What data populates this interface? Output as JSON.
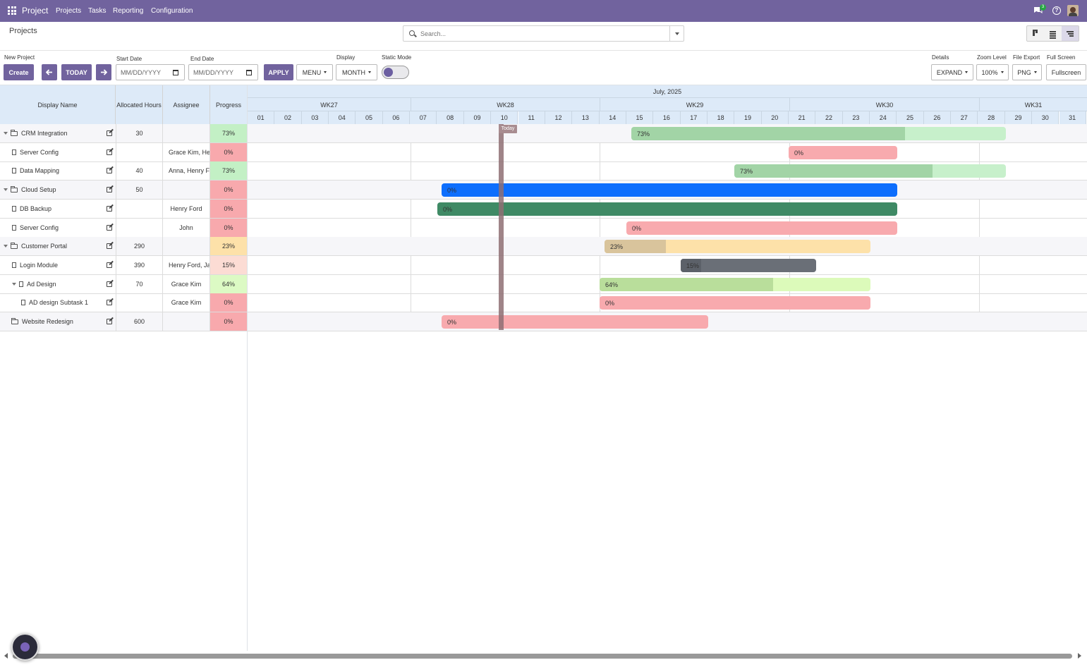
{
  "topbar": {
    "app": "Project",
    "menu": [
      "Projects",
      "Tasks",
      "Reporting",
      "Configuration"
    ],
    "badge": "3",
    "help": "?"
  },
  "control": {
    "breadcrumb": "Projects",
    "search_placeholder": "Search..."
  },
  "toolbar": {
    "new_project_label": "New Project",
    "create": "Create",
    "today": "TODAY",
    "start_date_label": "Start Date",
    "start_placeholder": "MM/DD/YYYY",
    "end_date_label": "End Date",
    "end_placeholder": "MM/DD/YYYY",
    "apply": "APPLY",
    "menu": "MENU",
    "display_label": "Display",
    "display_value": "MONTH",
    "static_label": "Static Mode",
    "static_on": false,
    "details_label": "Details",
    "details_value": "EXPAND",
    "zoom_label": "Zoom Level",
    "zoom_value": "100%",
    "export_label": "File Export",
    "export_value": "PNG",
    "fullscreen_label": "Full Screen",
    "fullscreen_value": "Fullscreen"
  },
  "columns": {
    "name": "Display Name",
    "hours": "Allocated Hours",
    "assignee": "Assignee",
    "progress": "Progress"
  },
  "timeline": {
    "month": "July, 2025",
    "weeks": [
      "WK27",
      "WK28",
      "WK29",
      "WK30",
      "WK31"
    ],
    "days": [
      "01",
      "02",
      "03",
      "04",
      "05",
      "06",
      "07",
      "08",
      "09",
      "10",
      "11",
      "12",
      "13",
      "14",
      "15",
      "16",
      "17",
      "18",
      "19",
      "20",
      "21",
      "22",
      "23",
      "24",
      "25",
      "26",
      "27",
      "28",
      "29",
      "30",
      "31"
    ],
    "today_label": "Today"
  },
  "rows": [
    {
      "name": "CRM Integration",
      "level": 0,
      "type": "project",
      "hours": "30",
      "assignee": "",
      "progress": "73%",
      "prog_bg": "#c3f0c5",
      "bar_color": "#c7f0cb",
      "fill_color": "#a2d4a6",
      "fill_pct": 0.73,
      "bar_label": "73%"
    },
    {
      "name": "Server Config",
      "level": 1,
      "type": "task",
      "hours": "",
      "assignee": "Grace Kim, Henry Ford",
      "progress": "0%",
      "prog_bg": "#f8a9ad",
      "bar_color": "#f8aaae",
      "fill_color": "#f8aaae",
      "fill_pct": 0,
      "bar_label": "0%"
    },
    {
      "name": "Data Mapping",
      "level": 1,
      "type": "task",
      "hours": "40",
      "assignee": "Anna, Henry Ford",
      "progress": "73%",
      "prog_bg": "#c3f0c5",
      "bar_color": "#c7f0cb",
      "fill_color": "#a2d4a6",
      "fill_pct": 0.73,
      "bar_label": "73%"
    },
    {
      "name": "Cloud Setup",
      "level": 0,
      "type": "project",
      "hours": "50",
      "assignee": "",
      "progress": "0%",
      "prog_bg": "#f8a9ad",
      "bar_color": "#0d6efd",
      "fill_color": "#0d6efd",
      "fill_pct": 0,
      "bar_label": "0%"
    },
    {
      "name": "DB Backup",
      "level": 1,
      "type": "task",
      "hours": "",
      "assignee": "Henry Ford",
      "progress": "0%",
      "prog_bg": "#f8a9ad",
      "bar_color": "#3f8a65",
      "fill_color": "#3f8a65",
      "fill_pct": 0,
      "bar_label": "0%"
    },
    {
      "name": "Server Config",
      "level": 1,
      "type": "task",
      "hours": "",
      "assignee": "John",
      "progress": "0%",
      "prog_bg": "#f8a9ad",
      "bar_color": "#f8aaae",
      "fill_color": "#f8aaae",
      "fill_pct": 0,
      "bar_label": "0%"
    },
    {
      "name": "Customer Portal",
      "level": 0,
      "type": "project",
      "hours": "290",
      "assignee": "",
      "progress": "23%",
      "prog_bg": "#fde1a9",
      "bar_color": "#fde1a9",
      "fill_color": "#d9c49c",
      "fill_pct": 0.23,
      "bar_label": "23%"
    },
    {
      "name": "Login Module",
      "level": 1,
      "type": "task",
      "hours": "390",
      "assignee": "Henry Ford, Jack",
      "progress": "15%",
      "prog_bg": "#fcdcd4",
      "bar_color": "#6a6f77",
      "fill_color": "#5c6169",
      "fill_pct": 0.15,
      "bar_label": "15%"
    },
    {
      "name": "Ad Design",
      "level": 1,
      "type": "task",
      "hours": "70",
      "assignee": "Grace Kim",
      "progress": "64%",
      "prog_bg": "#dcfac4",
      "bar_color": "#dcfaba",
      "fill_color": "#b9de9b",
      "fill_pct": 0.64,
      "bar_label": "64%"
    },
    {
      "name": "AD design Subtask 1",
      "level": 2,
      "type": "task",
      "hours": "",
      "assignee": "Grace Kim",
      "progress": "0%",
      "prog_bg": "#f8a9ad",
      "bar_color": "#f8aaae",
      "fill_color": "#f8aaae",
      "fill_pct": 0,
      "bar_label": "0%"
    },
    {
      "name": "Website Redesign",
      "level": 0,
      "type": "project",
      "hours": "600",
      "assignee": "",
      "progress": "0%",
      "prog_bg": "#f8a9ad",
      "bar_color": "#f8aaae",
      "fill_color": "#f8aaae",
      "fill_pct": 0,
      "bar_label": "0%"
    }
  ]
}
